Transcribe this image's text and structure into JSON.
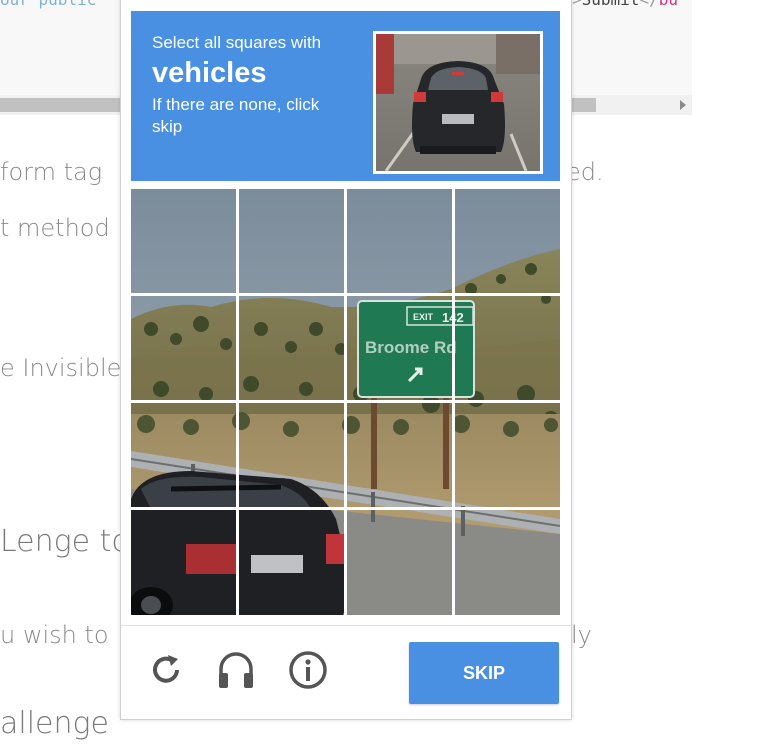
{
  "background_page": {
    "code_left": "our public",
    "code_right_pre": ">",
    "code_right_word": "Submit",
    "code_right_post": "</",
    "code_right_tail": "bu",
    "lines": [
      {
        "text": "form tag ",
        "right": "ed."
      },
      {
        "text": "t method"
      },
      {
        "text": "e Invisible"
      },
      {
        "text": "Lenge to"
      },
      {
        "text": "u wish to ",
        "right": "ly"
      },
      {
        "text": "allenge"
      }
    ]
  },
  "captcha": {
    "instruction_prefix": "Select all squares with",
    "target_object": "vehicles",
    "instruction_suffix": "If there are none, click skip",
    "grid": {
      "rows": 4,
      "cols": 4
    },
    "sign_exit_label": "EXIT",
    "sign_exit_number": "142",
    "sign_text": "Broome Rd",
    "skip_label": "SKIP",
    "colors": {
      "header": "#4a90e2",
      "button": "#4a90e2",
      "icon": "#555555"
    },
    "icons": [
      "reload-icon",
      "audio-icon",
      "info-icon"
    ]
  }
}
